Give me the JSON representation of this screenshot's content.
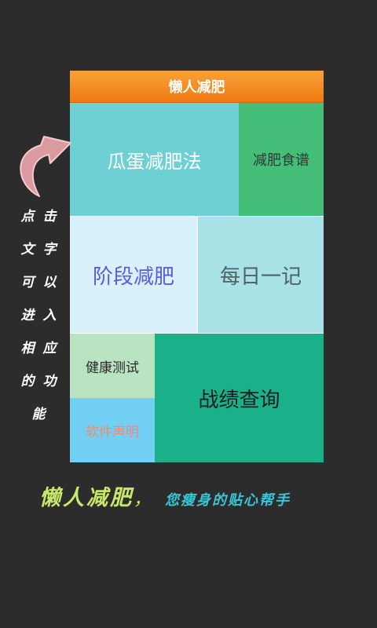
{
  "header": {
    "title": "懒人减肥"
  },
  "tiles": {
    "guadan": "瓜蛋减肥法",
    "recipes": "减肥食谱",
    "stage": "阶段减肥",
    "daily": "每日一记",
    "health": "健康测试",
    "software": "软件声明",
    "records": "战绩查询"
  },
  "hint": {
    "lines": [
      [
        "点",
        "击"
      ],
      [
        "文",
        "字"
      ],
      [
        "可",
        "以"
      ],
      [
        "进",
        "入"
      ],
      [
        "相",
        "应"
      ],
      [
        "的",
        "功"
      ],
      [
        "能"
      ]
    ]
  },
  "slogan": {
    "main": "懒人减肥",
    "comma": "，",
    "sub": "您瘦身的贴心帮手"
  },
  "icons": {
    "arrow": "curved-arrow-icon"
  },
  "colors": {
    "header": "#ee7a10",
    "arrow": "#d99aa0",
    "slogan_main": "#c9e86a",
    "slogan_sub": "#37c8d8"
  }
}
